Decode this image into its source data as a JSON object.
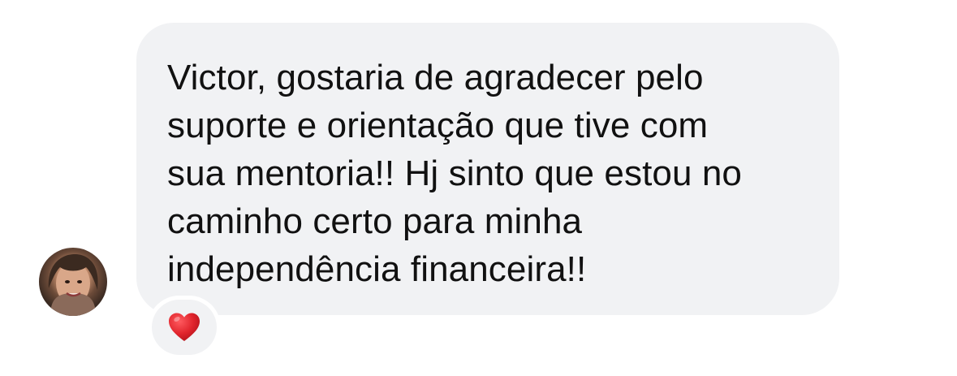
{
  "message": {
    "text": "Victor, gostaria de agradecer pelo\nsuporte e orientação que tive com\nsua mentoria!! Hj sinto que estou no\ncaminho certo para minha\nindependência financeira!!",
    "reaction_icon": "red-heart-icon",
    "bubble_color": "#f1f2f4",
    "text_color": "#111111",
    "reaction_color": "#e0242c"
  },
  "sender": {
    "avatar_icon": "user-avatar"
  }
}
